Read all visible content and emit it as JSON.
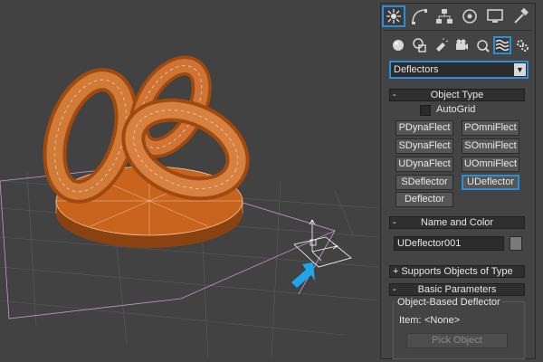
{
  "command_panel": {
    "tabs": [
      {
        "name": "create-tab",
        "icon": "sun-star-icon",
        "active": true
      },
      {
        "name": "modify-tab",
        "icon": "curve-icon",
        "active": false
      },
      {
        "name": "hierarchy-tab",
        "icon": "hierarchy-icon",
        "active": false
      },
      {
        "name": "motion-tab",
        "icon": "motion-circle-icon",
        "active": false
      },
      {
        "name": "display-tab",
        "icon": "monitor-icon",
        "active": false
      },
      {
        "name": "utilities-tab",
        "icon": "hammer-icon",
        "active": false
      }
    ],
    "subtabs": [
      {
        "name": "geometry",
        "icon": "sphere-icon"
      },
      {
        "name": "shapes",
        "icon": "shapes-icon"
      },
      {
        "name": "lights",
        "icon": "light-icon"
      },
      {
        "name": "cameras",
        "icon": "camera-icon"
      },
      {
        "name": "helpers",
        "icon": "helper-icon"
      },
      {
        "name": "space-warps",
        "icon": "waves-icon"
      },
      {
        "name": "systems",
        "icon": "gears-icon"
      }
    ],
    "category_dropdown": "Deflectors",
    "object_type": {
      "title": "Object Type",
      "toggle": "-",
      "autogrid_label": "AutoGrid",
      "autogrid_checked": false,
      "buttons": [
        "PDynaFlect",
        "POmniFlect",
        "SDynaFlect",
        "SOmniFlect",
        "UDynaFlect",
        "UOmniFlect",
        "SDeflector",
        "UDeflector",
        "Deflector"
      ],
      "active_button": "UDeflector"
    },
    "name_and_color": {
      "title": "Name and Color",
      "toggle": "-",
      "name_value": "UDeflector001",
      "color": "#7a7a7a"
    },
    "supports_objects": {
      "title": "Supports Objects of Type",
      "toggle": "+"
    },
    "basic_parameters": {
      "title": "Basic Parameters",
      "toggle": "-",
      "group_title": "Object-Based Deflector",
      "item_label": "Item:",
      "item_value": "<None>",
      "pick_button": "Pick Object"
    }
  },
  "colors": {
    "accent": "#2a8fd8",
    "object_orange": "#c8641e",
    "arrow_blue": "#1fa5ea",
    "grid_pink": "#c896c8"
  }
}
